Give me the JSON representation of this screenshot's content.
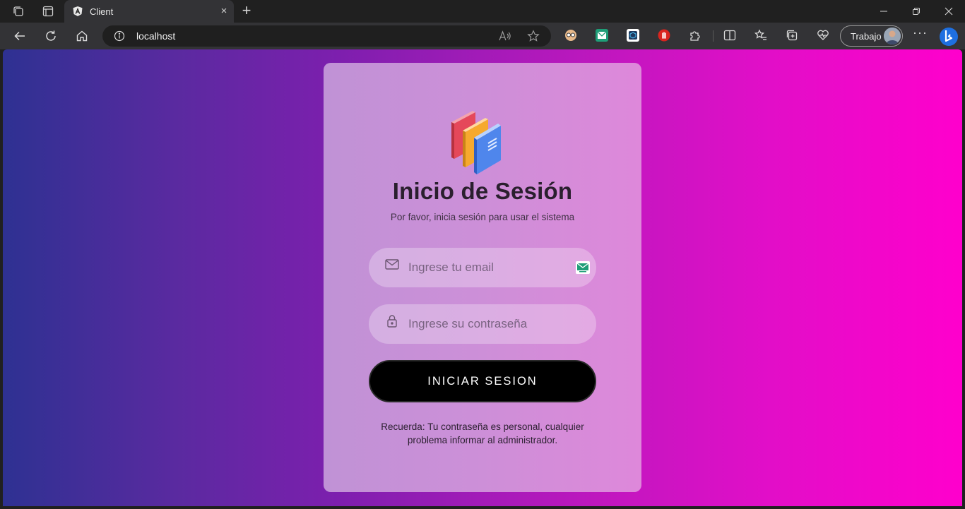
{
  "browser": {
    "tab": {
      "title": "Client",
      "close_glyph": "×"
    },
    "new_tab_glyph": "+",
    "address": {
      "url": "localhost"
    },
    "profile": {
      "label": "Trabajo"
    },
    "more_glyph": "···",
    "window_controls": [
      "minimize",
      "restore",
      "close"
    ]
  },
  "login": {
    "title": "Inicio de Sesión",
    "subtitle": "Por favor, inicia sesión para usar el sistema",
    "email": {
      "placeholder": "Ingrese tu email",
      "value": ""
    },
    "password": {
      "placeholder": "Ingrese su contraseña",
      "value": ""
    },
    "submit_label": "INICIAR SESION",
    "note": "Recuerda: Tu contraseña es personal, cualquier problema informar al administrador."
  },
  "colors": {
    "gradient_start": "#2e3192",
    "gradient_end": "#ff00cc",
    "card": "#cd8fd8",
    "button": "#000000"
  }
}
